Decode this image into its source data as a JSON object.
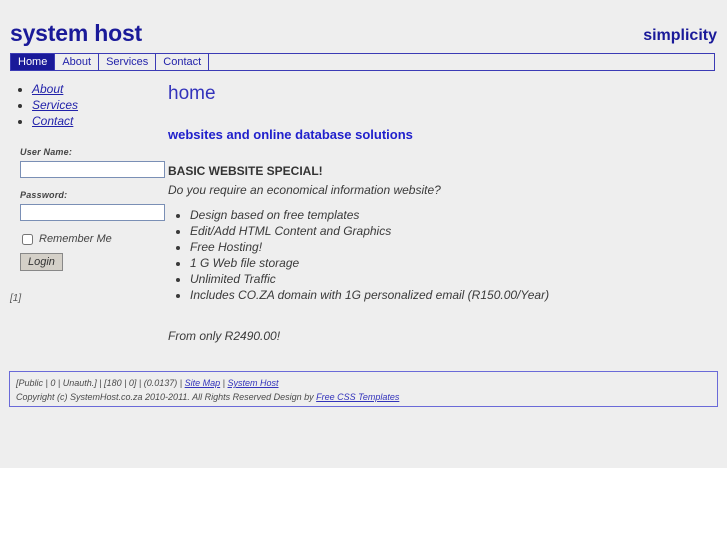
{
  "header": {
    "logo": "system host",
    "tagline": "simplicity"
  },
  "nav": {
    "items": [
      {
        "label": "Home",
        "active": true
      },
      {
        "label": "About",
        "active": false
      },
      {
        "label": "Services",
        "active": false
      },
      {
        "label": "Contact",
        "active": false
      }
    ]
  },
  "sidebar": {
    "links": [
      {
        "label": "About"
      },
      {
        "label": "Services"
      },
      {
        "label": "Contact"
      }
    ],
    "login": {
      "username_label": "User Name:",
      "username_value": "",
      "password_label": "Password:",
      "password_value": "",
      "remember_label": "Remember Me",
      "remember_checked": false,
      "button_label": "Login"
    },
    "pager": "[1]"
  },
  "content": {
    "page_title": "home",
    "subtitle": "websites and online database solutions",
    "special_heading": "BASIC WEBSITE SPECIAL!",
    "intro": "Do you require an economical information website?",
    "features": [
      "Design based on free templates",
      "Edit/Add HTML Content and Graphics",
      "Free Hosting!",
      "1 G Web file storage",
      "Unlimited Traffic",
      "Includes CO.ZA domain with 1G personalized email (R150.00/Year)"
    ],
    "price": "From only R2490.00!"
  },
  "footer": {
    "status_prefix": "[Public | 0 | Unauth.] | [180 | 0] | (0.0137) | ",
    "sep": " | ",
    "sitemap_link": "Site Map",
    "systemhost_link": "System Host",
    "copyright_prefix": "Copyright (c) SystemHost.co.za 2010-2011. All Rights Reserved Design by ",
    "template_link": "Free CSS Templates"
  },
  "colors": {
    "page_background": "#eeeeee",
    "brand_blue": "#1a1a99",
    "nav_border": "#3b3bb5",
    "link_blue": "#2222aa",
    "heading_blue": "#3333bb",
    "footer_border": "#6a6ad8",
    "input_border": "#7a8fb5"
  }
}
